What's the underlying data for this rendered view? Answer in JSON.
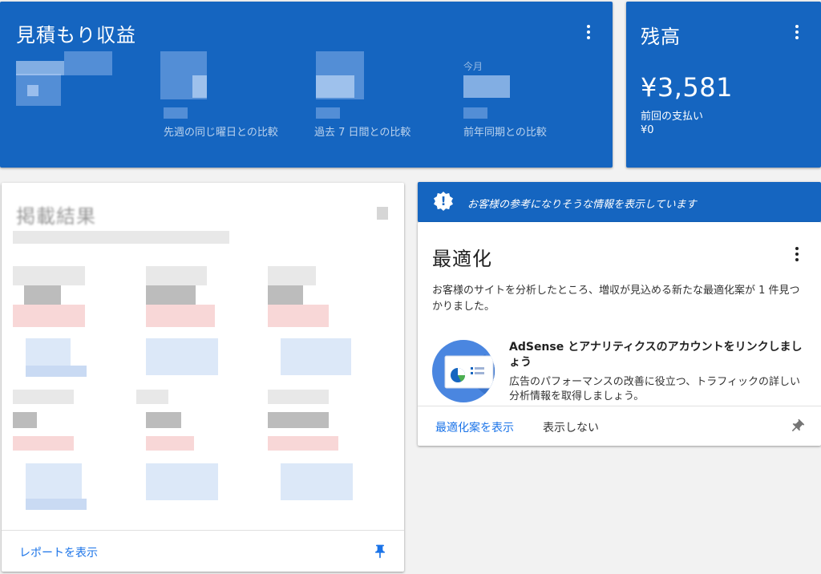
{
  "earnings": {
    "title": "見積もり収益",
    "metrics": [
      {
        "top": "",
        "value": "",
        "compare": ""
      },
      {
        "top": "",
        "value": "",
        "compare": "先週の同じ曜日との比較"
      },
      {
        "top": "",
        "value": "",
        "compare": "過去 7 日間との比較"
      },
      {
        "top": "今月",
        "value": "",
        "compare": "前年同期との比較"
      }
    ]
  },
  "balance": {
    "title": "残高",
    "amount": "¥3,581",
    "last_payment_label": "前回の支払い",
    "last_payment_value": "¥0"
  },
  "performance": {
    "title": "掲載結果",
    "view_report": "レポートを表示"
  },
  "notice": {
    "text": "お客様の参考になりそうな情報を表示しています"
  },
  "optimize": {
    "title": "最適化",
    "description": "お客様のサイトを分析したところ、増収が見込める新たな最適化案が 1 件見つかりました。",
    "rec_title": "AdSense とアナリティクスのアカウントをリンクしましょう",
    "rec_description": "広告のパフォーマンスの改善に役立つ、トラフィックの詳しい分析情報を取得しましょう。",
    "show_button": "最適化案を表示",
    "dismiss_button": "表示しない"
  },
  "colors": {
    "primary_blue": "#1565c0",
    "link_blue": "#1a73e8"
  }
}
